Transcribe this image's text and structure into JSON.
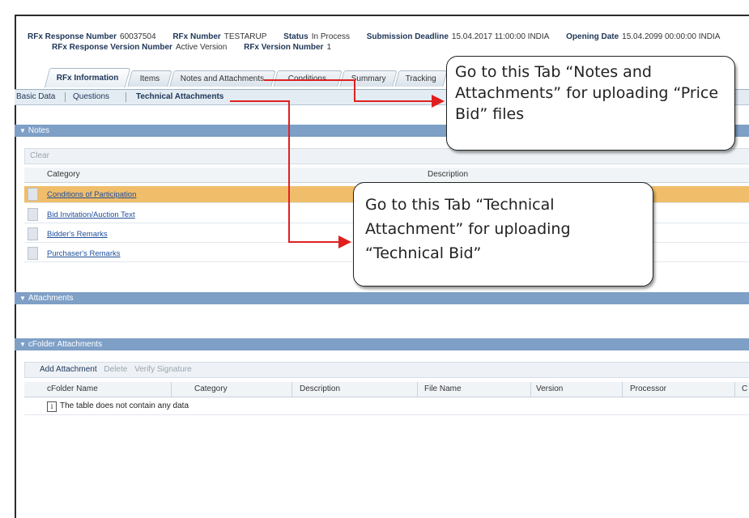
{
  "header": {
    "rfx_response_number_label": "RFx Response Number",
    "rfx_response_number": "60037504",
    "rfx_number_label": "RFx Number",
    "rfx_number": "TESTARUP",
    "status_label": "Status",
    "status": "In Process",
    "submission_deadline_label": "Submission Deadline",
    "submission_deadline": "15.04.2017 11:00:00 INDIA",
    "opening_date_label": "Opening Date",
    "opening_date": "15.04.2099 00:00:00 INDIA",
    "response_version_label": "RFx Response Version Number",
    "response_version": "Active Version",
    "rfx_version_label": "RFx Version Number",
    "rfx_version": "1"
  },
  "tabs": [
    "RFx Information",
    "Items",
    "Notes and Attachments",
    "Conditions",
    "Summary",
    "Tracking"
  ],
  "subtabs": [
    "Basic Data",
    "Questions",
    "Technical Attachments"
  ],
  "notes": {
    "title": "Notes",
    "clear_label": "Clear",
    "columns": [
      "Category",
      "Description"
    ],
    "rows": [
      "Conditions of Participation",
      "Bid Invitation/Auction Text",
      "Bidder's Remarks",
      "Purchaser's Remarks"
    ]
  },
  "attachments": {
    "title": "Attachments"
  },
  "cfolder": {
    "title": "cFolder Attachments",
    "toolbar": [
      "Add Attachment",
      "Delete",
      "Verify Signature"
    ],
    "columns": [
      "cFolder Name",
      "Category",
      "Description",
      "File Name",
      "Version",
      "Processor",
      "C"
    ],
    "empty_message": "The table does not contain any data"
  },
  "callouts": {
    "price_bid": "Go to this Tab “Notes and Attachments” for uploading “Price Bid” files",
    "technical_bid": "Go to this Tab “Technical Attachment” for uploading “Technical Bid”"
  },
  "colors": {
    "section_bar": "#7e9fc6",
    "highlight_row": "#f0bd6a",
    "arrow": "#e02020",
    "link": "#1f4e9a"
  }
}
